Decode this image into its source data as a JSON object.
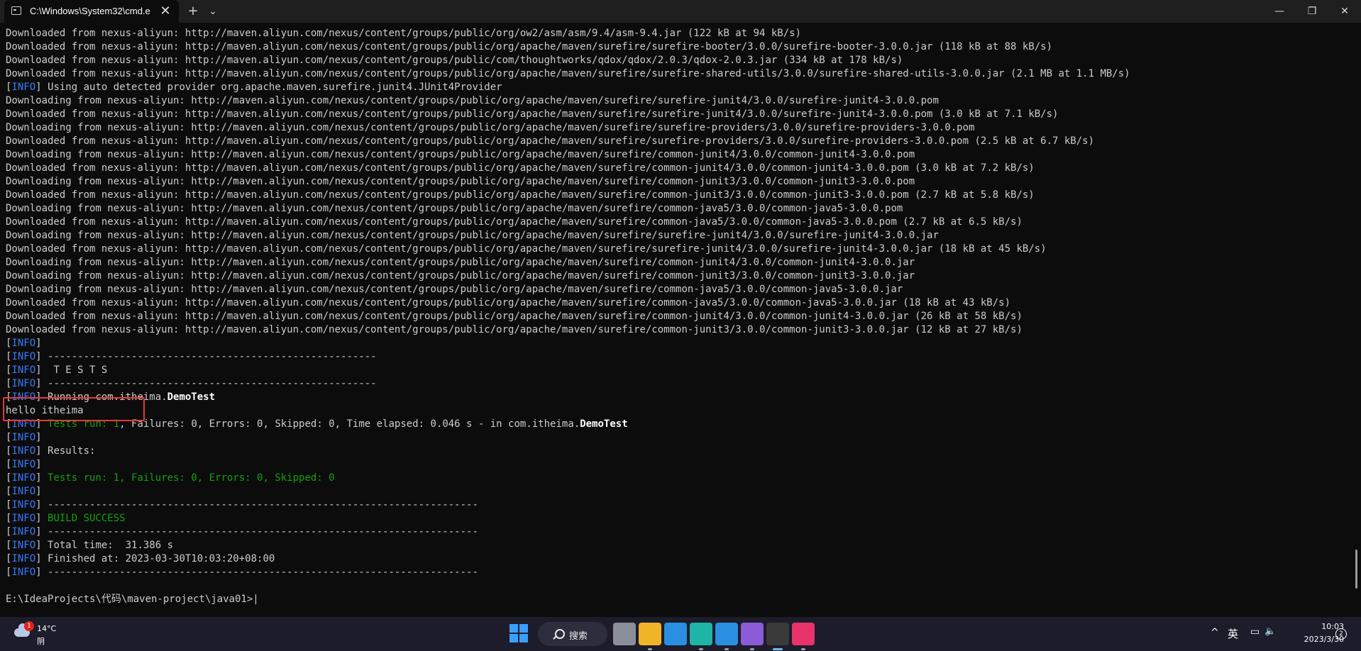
{
  "window": {
    "tab_title": "C:\\Windows\\System32\\cmd.e",
    "close_tab": "✕",
    "new_tab": "+",
    "dropdown": "⌄",
    "minimize": "—",
    "maximize": "❐",
    "close": "✕"
  },
  "colors": {
    "info_tag": "#3b78ff",
    "success_green": "#13a10e",
    "highlight_border": "#e53935",
    "background": "#0c0c0c"
  },
  "console": {
    "lines": [
      [
        {
          "t": "Downloaded from nexus-aliyun: http://maven.aliyun.com/nexus/content/groups/public/org/ow2/asm/asm/9.4/asm-9.4.jar (122 kB at 94 kB/s)"
        }
      ],
      [
        {
          "t": "Downloaded from nexus-aliyun: http://maven.aliyun.com/nexus/content/groups/public/org/apache/maven/surefire/surefire-booter/3.0.0/surefire-booter-3.0.0.jar (118 kB at 88 kB/s)"
        }
      ],
      [
        {
          "t": "Downloaded from nexus-aliyun: http://maven.aliyun.com/nexus/content/groups/public/com/thoughtworks/qdox/qdox/2.0.3/qdox-2.0.3.jar (334 kB at 178 kB/s)"
        }
      ],
      [
        {
          "t": "Downloaded from nexus-aliyun: http://maven.aliyun.com/nexus/content/groups/public/org/apache/maven/surefire/surefire-shared-utils/3.0.0/surefire-shared-utils-3.0.0.jar (2.1 MB at 1.1 MB/s)"
        }
      ],
      [
        {
          "t": "["
        },
        {
          "t": "INFO",
          "c": "info"
        },
        {
          "t": "] Using auto detected provider org.apache.maven.surefire.junit4.JUnit4Provider"
        }
      ],
      [
        {
          "t": "Downloading from nexus-aliyun: http://maven.aliyun.com/nexus/content/groups/public/org/apache/maven/surefire/surefire-junit4/3.0.0/surefire-junit4-3.0.0.pom"
        }
      ],
      [
        {
          "t": "Downloaded from nexus-aliyun: http://maven.aliyun.com/nexus/content/groups/public/org/apache/maven/surefire/surefire-junit4/3.0.0/surefire-junit4-3.0.0.pom (3.0 kB at 7.1 kB/s)"
        }
      ],
      [
        {
          "t": "Downloading from nexus-aliyun: http://maven.aliyun.com/nexus/content/groups/public/org/apache/maven/surefire/surefire-providers/3.0.0/surefire-providers-3.0.0.pom"
        }
      ],
      [
        {
          "t": "Downloaded from nexus-aliyun: http://maven.aliyun.com/nexus/content/groups/public/org/apache/maven/surefire/surefire-providers/3.0.0/surefire-providers-3.0.0.pom (2.5 kB at 6.7 kB/s)"
        }
      ],
      [
        {
          "t": "Downloading from nexus-aliyun: http://maven.aliyun.com/nexus/content/groups/public/org/apache/maven/surefire/common-junit4/3.0.0/common-junit4-3.0.0.pom"
        }
      ],
      [
        {
          "t": "Downloaded from nexus-aliyun: http://maven.aliyun.com/nexus/content/groups/public/org/apache/maven/surefire/common-junit4/3.0.0/common-junit4-3.0.0.pom (3.0 kB at 7.2 kB/s)"
        }
      ],
      [
        {
          "t": "Downloading from nexus-aliyun: http://maven.aliyun.com/nexus/content/groups/public/org/apache/maven/surefire/common-junit3/3.0.0/common-junit3-3.0.0.pom"
        }
      ],
      [
        {
          "t": "Downloaded from nexus-aliyun: http://maven.aliyun.com/nexus/content/groups/public/org/apache/maven/surefire/common-junit3/3.0.0/common-junit3-3.0.0.pom (2.7 kB at 5.8 kB/s)"
        }
      ],
      [
        {
          "t": "Downloading from nexus-aliyun: http://maven.aliyun.com/nexus/content/groups/public/org/apache/maven/surefire/common-java5/3.0.0/common-java5-3.0.0.pom"
        }
      ],
      [
        {
          "t": "Downloaded from nexus-aliyun: http://maven.aliyun.com/nexus/content/groups/public/org/apache/maven/surefire/common-java5/3.0.0/common-java5-3.0.0.pom (2.7 kB at 6.5 kB/s)"
        }
      ],
      [
        {
          "t": "Downloading from nexus-aliyun: http://maven.aliyun.com/nexus/content/groups/public/org/apache/maven/surefire/surefire-junit4/3.0.0/surefire-junit4-3.0.0.jar"
        }
      ],
      [
        {
          "t": "Downloaded from nexus-aliyun: http://maven.aliyun.com/nexus/content/groups/public/org/apache/maven/surefire/surefire-junit4/3.0.0/surefire-junit4-3.0.0.jar (18 kB at 45 kB/s)"
        }
      ],
      [
        {
          "t": "Downloading from nexus-aliyun: http://maven.aliyun.com/nexus/content/groups/public/org/apache/maven/surefire/common-junit4/3.0.0/common-junit4-3.0.0.jar"
        }
      ],
      [
        {
          "t": "Downloading from nexus-aliyun: http://maven.aliyun.com/nexus/content/groups/public/org/apache/maven/surefire/common-junit3/3.0.0/common-junit3-3.0.0.jar"
        }
      ],
      [
        {
          "t": "Downloading from nexus-aliyun: http://maven.aliyun.com/nexus/content/groups/public/org/apache/maven/surefire/common-java5/3.0.0/common-java5-3.0.0.jar"
        }
      ],
      [
        {
          "t": "Downloaded from nexus-aliyun: http://maven.aliyun.com/nexus/content/groups/public/org/apache/maven/surefire/common-java5/3.0.0/common-java5-3.0.0.jar (18 kB at 43 kB/s)"
        }
      ],
      [
        {
          "t": "Downloaded from nexus-aliyun: http://maven.aliyun.com/nexus/content/groups/public/org/apache/maven/surefire/common-junit4/3.0.0/common-junit4-3.0.0.jar (26 kB at 58 kB/s)"
        }
      ],
      [
        {
          "t": "Downloaded from nexus-aliyun: http://maven.aliyun.com/nexus/content/groups/public/org/apache/maven/surefire/common-junit3/3.0.0/common-junit3-3.0.0.jar (12 kB at 27 kB/s)"
        }
      ],
      [
        {
          "t": "["
        },
        {
          "t": "INFO",
          "c": "info"
        },
        {
          "t": "]"
        }
      ],
      [
        {
          "t": "["
        },
        {
          "t": "INFO",
          "c": "info"
        },
        {
          "t": "] -------------------------------------------------------"
        }
      ],
      [
        {
          "t": "["
        },
        {
          "t": "INFO",
          "c": "info"
        },
        {
          "t": "]  T E S T S"
        }
      ],
      [
        {
          "t": "["
        },
        {
          "t": "INFO",
          "c": "info"
        },
        {
          "t": "] -------------------------------------------------------"
        }
      ],
      [
        {
          "t": "["
        },
        {
          "t": "INFO",
          "c": "info"
        },
        {
          "t": "] Running com.itheima."
        },
        {
          "t": "DemoTest",
          "c": "bold"
        }
      ],
      [
        {
          "t": "hello itheima"
        }
      ],
      [
        {
          "t": "["
        },
        {
          "t": "INFO",
          "c": "info"
        },
        {
          "t": "] "
        },
        {
          "t": "Tests run: 1",
          "c": "green"
        },
        {
          "t": ", Failures: 0, Errors: 0, Skipped: 0, Time elapsed: 0.046 s - in com.itheima."
        },
        {
          "t": "DemoTest",
          "c": "bold"
        }
      ],
      [
        {
          "t": "["
        },
        {
          "t": "INFO",
          "c": "info"
        },
        {
          "t": "]"
        }
      ],
      [
        {
          "t": "["
        },
        {
          "t": "INFO",
          "c": "info"
        },
        {
          "t": "] Results:"
        }
      ],
      [
        {
          "t": "["
        },
        {
          "t": "INFO",
          "c": "info"
        },
        {
          "t": "]"
        }
      ],
      [
        {
          "t": "["
        },
        {
          "t": "INFO",
          "c": "info"
        },
        {
          "t": "] "
        },
        {
          "t": "Tests run: 1, Failures: 0, Errors: 0, Skipped: 0",
          "c": "green"
        }
      ],
      [
        {
          "t": "["
        },
        {
          "t": "INFO",
          "c": "info"
        },
        {
          "t": "]"
        }
      ],
      [
        {
          "t": "["
        },
        {
          "t": "INFO",
          "c": "info"
        },
        {
          "t": "] ------------------------------------------------------------------------"
        }
      ],
      [
        {
          "t": "["
        },
        {
          "t": "INFO",
          "c": "info"
        },
        {
          "t": "] "
        },
        {
          "t": "BUILD SUCCESS",
          "c": "green"
        }
      ],
      [
        {
          "t": "["
        },
        {
          "t": "INFO",
          "c": "info"
        },
        {
          "t": "] ------------------------------------------------------------------------"
        }
      ],
      [
        {
          "t": "["
        },
        {
          "t": "INFO",
          "c": "info"
        },
        {
          "t": "] Total time:  31.386 s"
        }
      ],
      [
        {
          "t": "["
        },
        {
          "t": "INFO",
          "c": "info"
        },
        {
          "t": "] Finished at: 2023-03-30T10:03:20+08:00"
        }
      ],
      [
        {
          "t": "["
        },
        {
          "t": "INFO",
          "c": "info"
        },
        {
          "t": "] ------------------------------------------------------------------------"
        }
      ],
      [
        {
          "t": ""
        }
      ],
      [
        {
          "t": "E:\\IdeaProjects\\代码\\maven-project\\java01>|"
        }
      ]
    ]
  },
  "taskbar": {
    "weather": {
      "temp": "14°C",
      "condition": "阴",
      "badge": "1"
    },
    "search_label": "搜索",
    "apps": [
      {
        "name": "task-view-icon",
        "color": "#8a8f99"
      },
      {
        "name": "file-explorer-icon",
        "color": "#f0b429"
      },
      {
        "name": "microsoft-store-icon",
        "color": "#2a8fe0"
      },
      {
        "name": "edge-browser-icon",
        "color": "#1eb4a6"
      },
      {
        "name": "vscode-icon",
        "color": "#2a8fe0"
      },
      {
        "name": "visual-studio-icon",
        "color": "#8c5bd8"
      },
      {
        "name": "terminal-icon",
        "color": "#3a3a3a"
      },
      {
        "name": "intellij-idea-icon",
        "color": "#e8336b"
      }
    ],
    "tray": {
      "chevron": "^",
      "ime": "英",
      "network": "▭",
      "volume": "🔈",
      "time": "10:03",
      "date": "2023/3/30",
      "notification_count": "2"
    }
  }
}
